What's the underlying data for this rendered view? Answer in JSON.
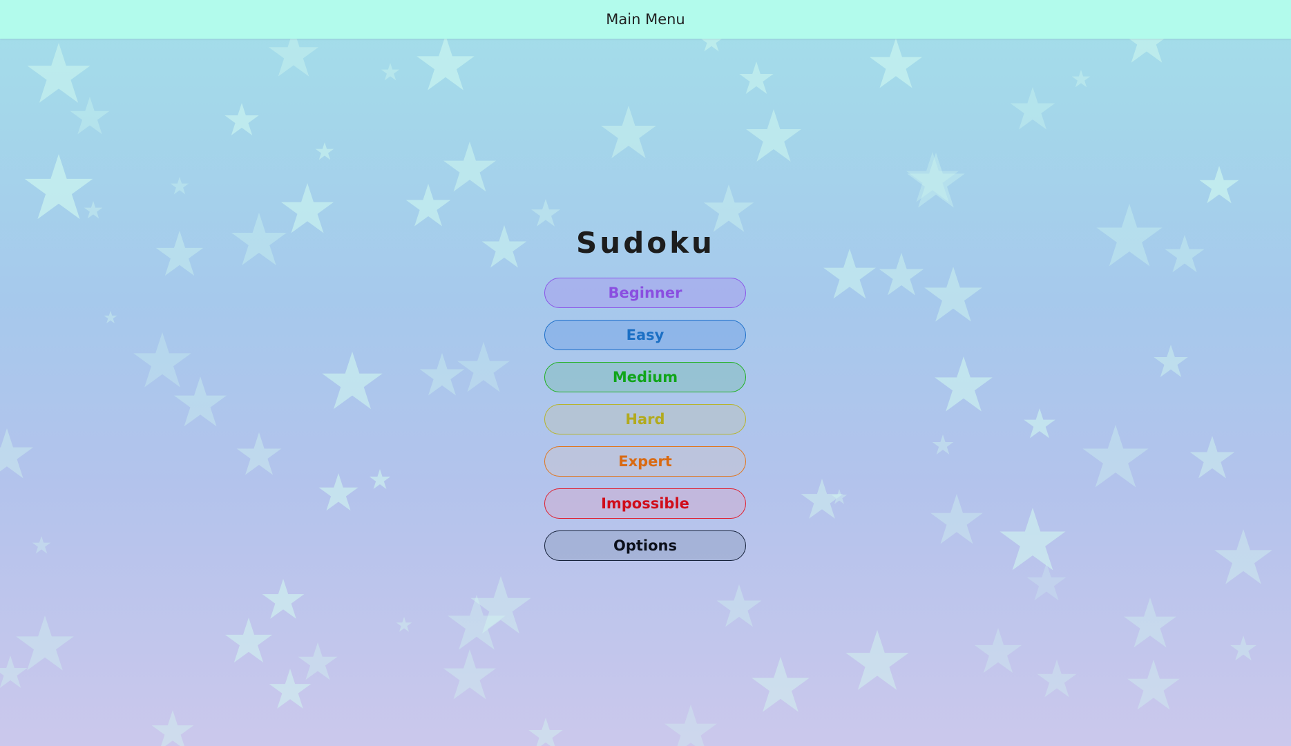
{
  "header": {
    "title": "Main Menu"
  },
  "game": {
    "title": "Sudoku"
  },
  "menu": {
    "beginner": "Beginner",
    "easy": "Easy",
    "medium": "Medium",
    "hard": "Hard",
    "expert": "Expert",
    "impossible": "Impossible",
    "options": "Options"
  },
  "colors": {
    "topbar": "#b2fbec",
    "beginner": "#8a4fe0",
    "easy": "#1b6fc4",
    "medium": "#10a51a",
    "hard": "#b2aa1d",
    "expert": "#d96a12",
    "impossible": "#d00d1a",
    "options": "#0b0f1a"
  },
  "background": {
    "pattern": "star-icon"
  }
}
